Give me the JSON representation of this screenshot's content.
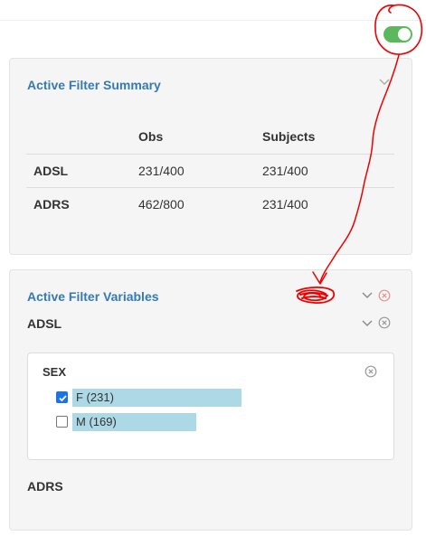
{
  "toggle": {
    "state": "on",
    "color": "#5cb85c"
  },
  "summary": {
    "title": "Active Filter Summary",
    "columns": [
      "",
      "Obs",
      "Subjects"
    ],
    "rows": [
      {
        "name": "ADSL",
        "obs": "231/400",
        "subjects": "231/400"
      },
      {
        "name": "ADRS",
        "obs": "462/800",
        "subjects": "231/400"
      }
    ]
  },
  "variables": {
    "title": "Active Filter Variables",
    "datasets": [
      {
        "name": "ADSL",
        "filters": [
          {
            "name": "SEX",
            "choices": [
              {
                "label": "F (231)",
                "checked": true,
                "count": 231
              },
              {
                "label": "M (169)",
                "checked": false,
                "count": 169
              }
            ]
          }
        ]
      },
      {
        "name": "ADRS",
        "filters": []
      }
    ]
  },
  "colors": {
    "title_blue": "#337ab7",
    "bar_blue": "#add8e6",
    "remove_red": "#e89090",
    "annotation_red": "#ee0000"
  },
  "icons": {
    "collapse": "chevron-down-icon",
    "remove": "circle-x-icon"
  }
}
